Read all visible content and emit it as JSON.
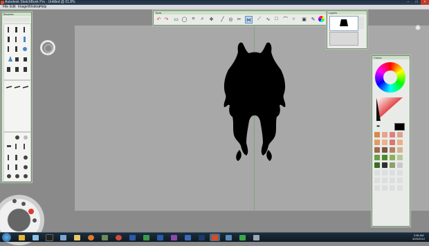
{
  "window": {
    "title": "Autodesk SketchBook Pro - Untitled @ 61.8%",
    "controls": [
      "minimize",
      "maximize",
      "close"
    ]
  },
  "menu": {
    "items": [
      "File",
      "Edit",
      "Image",
      "Window",
      "Help"
    ]
  },
  "panels": {
    "brushes": {
      "title": "Brushes"
    },
    "tools": {
      "title": "Tools"
    },
    "layers": {
      "title": "Layers"
    },
    "colors": {
      "title": "Colors"
    }
  },
  "toolbar_icons": [
    "undo-icon",
    "redo-icon",
    "select-rect-icon",
    "lasso-icon",
    "crop-icon",
    "zoom-icon",
    "move-icon",
    "line-icon",
    "ellipse-icon",
    "symmetry-icon",
    "ruler-icon",
    "curve-icon",
    "rect-icon",
    "polyline-icon",
    "circle-icon",
    "text-icon",
    "import-icon",
    "brush-icon",
    "color-wheel-icon"
  ],
  "swatches": [
    "#d8894d",
    "#e8a38c",
    "#e07f83",
    "#d8a58a",
    "#e29a66",
    "#efb18f",
    "#d37b6e",
    "#e8b08c",
    "#9c6a4d",
    "#7a5540",
    "#b48063",
    "#d5b390",
    "#6da044",
    "#4a8a2e",
    "#8fb05a",
    "#b5c89a",
    "#3d6b2a",
    "#2f2f2f",
    "#8aa06e",
    "#c9c9c9"
  ],
  "colors_current": {
    "primary": "#000000",
    "secondary": "#ffffff"
  },
  "taskbar": {
    "time": "3:38 AM",
    "date": "6/20/2012"
  }
}
